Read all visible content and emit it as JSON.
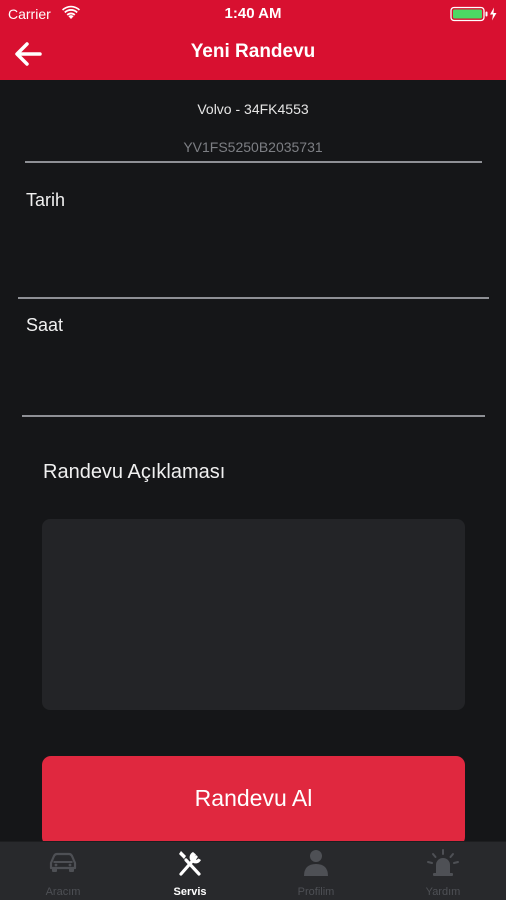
{
  "status_bar": {
    "carrier": "Carrier",
    "time": "1:40 AM"
  },
  "nav": {
    "title": "Yeni Randevu"
  },
  "vehicle": {
    "name": "Volvo - 34FK4553",
    "vin": "YV1FS5250B2035731"
  },
  "form": {
    "date_label": "Tarih",
    "time_label": "Saat",
    "description_label": "Randevu Açıklaması",
    "description_value": "",
    "submit_label": "Randevu Al"
  },
  "tabbar": {
    "items": [
      {
        "label": "Aracım",
        "icon": "car-icon",
        "active": false
      },
      {
        "label": "Servis",
        "icon": "wrench-screwdriver-icon",
        "active": true
      },
      {
        "label": "Profilim",
        "icon": "person-icon",
        "active": false
      },
      {
        "label": "Yardım",
        "icon": "siren-icon",
        "active": false
      }
    ]
  },
  "colors": {
    "brand_red": "#d81030",
    "button_red": "#e0283f",
    "background": "#151618",
    "tabbar": "#28292c",
    "battery_green": "#4cd964"
  }
}
